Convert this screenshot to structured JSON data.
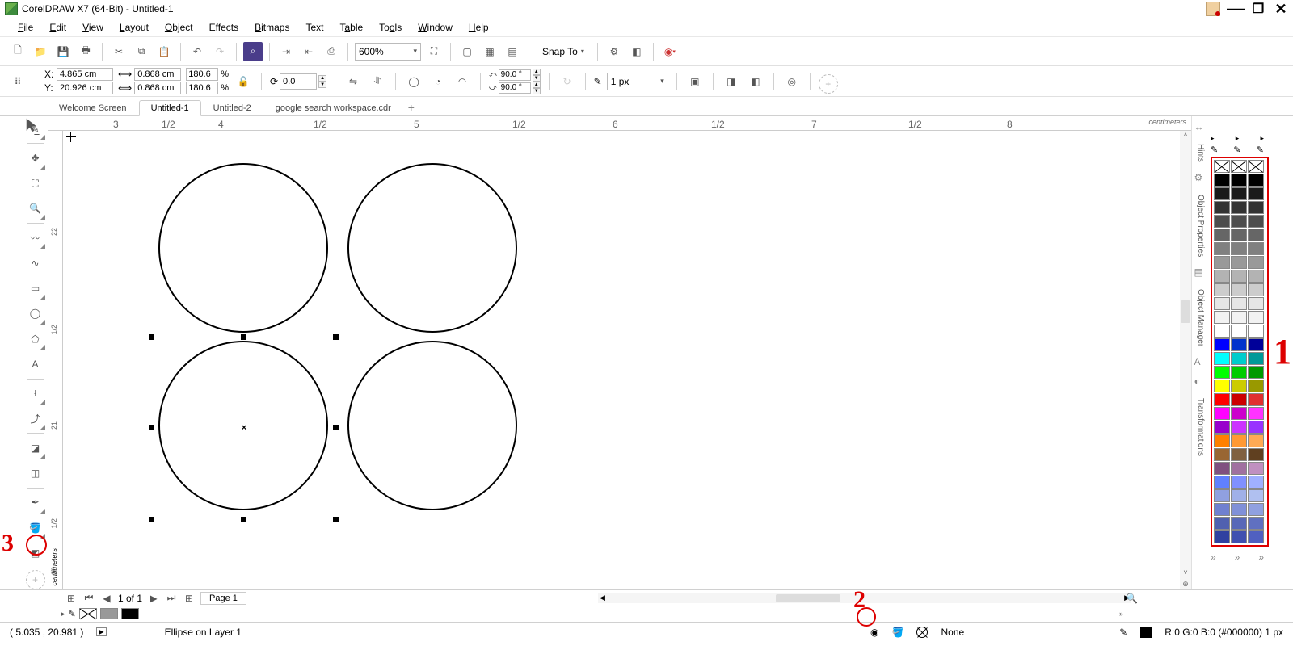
{
  "title": "CorelDRAW X7 (64-Bit) - Untitled-1",
  "menu": [
    "File",
    "Edit",
    "View",
    "Layout",
    "Object",
    "Effects",
    "Bitmaps",
    "Text",
    "Table",
    "Tools",
    "Window",
    "Help"
  ],
  "menu_accel": [
    0,
    0,
    0,
    0,
    0,
    -1,
    0,
    -1,
    1,
    2,
    0,
    0
  ],
  "toolbar": {
    "zoom": "600%",
    "snap": "Snap To"
  },
  "property_bar": {
    "x": "4.865 cm",
    "y": "20.926 cm",
    "w": "0.868 cm",
    "h": "0.868 cm",
    "sx": "180.6",
    "sy": "180.6",
    "rot": "0.0",
    "ang1": "90.0 °",
    "ang2": "90.0 °",
    "outline": "1 px"
  },
  "tabs": [
    "Welcome Screen",
    "Untitled-1",
    "Untitled-2",
    "google search workspace.cdr"
  ],
  "active_tab": 1,
  "ruler_unit": "centimeters",
  "ruler_top": [
    {
      "pos": 80,
      "label": "3"
    },
    {
      "pos": 140,
      "label": "1/2"
    },
    {
      "pos": 210,
      "label": "4"
    },
    {
      "pos": 328,
      "label": "1/2"
    },
    {
      "pos": 452,
      "label": "5"
    },
    {
      "pos": 574,
      "label": "1/2"
    },
    {
      "pos": 698,
      "label": "6"
    },
    {
      "pos": 820,
      "label": "1/2"
    },
    {
      "pos": 944,
      "label": "7"
    },
    {
      "pos": 1064,
      "label": "1/2"
    },
    {
      "pos": 1186,
      "label": "8"
    }
  ],
  "ruler_left": [
    {
      "pos": 120,
      "label": "22"
    },
    {
      "pos": 240,
      "label": "1/2"
    },
    {
      "pos": 360,
      "label": "21"
    },
    {
      "pos": 480,
      "label": "1/2"
    },
    {
      "pos": 540,
      "label": "20"
    }
  ],
  "page_nav": {
    "count": "1 of 1",
    "page_label": "Page 1"
  },
  "status": {
    "coords": "( 5.035 , 20.981 )",
    "object": "Ellipse on Layer 1",
    "fill": "None",
    "outline_info": "R:0 G:0 B:0 (#000000)  1 px"
  },
  "dockers": [
    "Hints",
    "Object Properties",
    "Object Manager",
    "Transformations"
  ],
  "palette": [
    "#000000",
    "#000000",
    "#000000",
    "#1a1a1a",
    "#1a1a1a",
    "#1a1a1a",
    "#333333",
    "#333333",
    "#333333",
    "#4d4d4d",
    "#4d4d4d",
    "#4d4d4d",
    "#666666",
    "#666666",
    "#666666",
    "#808080",
    "#808080",
    "#808080",
    "#999999",
    "#999999",
    "#999999",
    "#b3b3b3",
    "#b3b3b3",
    "#b3b3b3",
    "#cccccc",
    "#cccccc",
    "#cccccc",
    "#e6e6e6",
    "#e6e6e6",
    "#e6e6e6",
    "#f2f2f2",
    "#f2f2f2",
    "#f2f2f2",
    "#ffffff",
    "#ffffff",
    "#ffffff",
    "#0000ff",
    "#0033cc",
    "#000099",
    "#00ffff",
    "#00cccc",
    "#009999",
    "#00ff00",
    "#00cc00",
    "#009900",
    "#ffff00",
    "#cccc00",
    "#999900",
    "#ff0000",
    "#cc0000",
    "#e03030",
    "#ff00ff",
    "#cc00cc",
    "#ff33ff",
    "#9900cc",
    "#cc33ff",
    "#9933ff",
    "#ff8000",
    "#ff9933",
    "#ffaa55",
    "#996633",
    "#806040",
    "#604020",
    "#805080",
    "#a070a0",
    "#c090c0",
    "#6080ff",
    "#8090ff",
    "#a0b0ff",
    "#90a0e0",
    "#a0b0e8",
    "#b0c0f0",
    "#7080d0",
    "#8090d8",
    "#90a0e0",
    "#5060b0",
    "#5868b8",
    "#6070c0",
    "#3040a0",
    "#4050b0",
    "#5060c0"
  ],
  "annotations": {
    "a1": "1",
    "a2": "2",
    "a3": "3"
  }
}
